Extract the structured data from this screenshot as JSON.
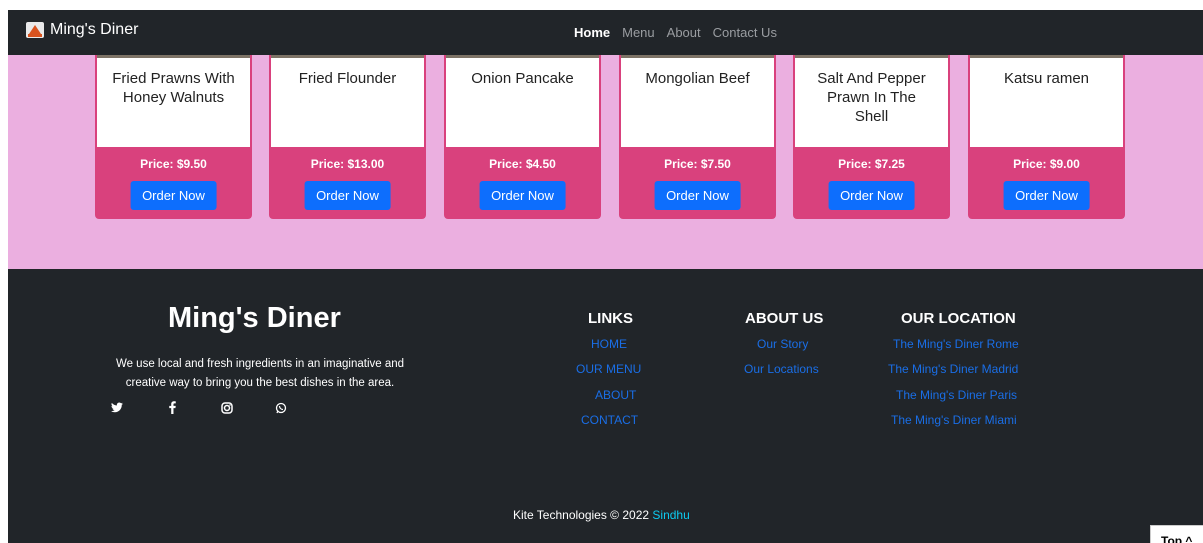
{
  "navbar": {
    "brand": "Ming's Diner",
    "links": [
      "Home",
      "Menu",
      "About",
      "Contact Us"
    ]
  },
  "menu": {
    "cards": [
      {
        "title": "Fried Prawns With Honey Walnuts",
        "price": "Price: $9.50",
        "button": "Order Now"
      },
      {
        "title": "Fried Flounder",
        "price": "Price: $13.00",
        "button": "Order Now"
      },
      {
        "title": "Onion Pancake",
        "price": "Price: $4.50",
        "button": "Order Now"
      },
      {
        "title": "Mongolian Beef",
        "price": "Price: $7.50",
        "button": "Order Now"
      },
      {
        "title": "Salt And Pepper Prawn In The Shell",
        "price": "Price: $7.25",
        "button": "Order Now"
      },
      {
        "title": "Katsu ramen",
        "price": "Price: $9.00",
        "button": "Order Now"
      }
    ]
  },
  "footer": {
    "title": "Ming's Diner",
    "description": "We use local and fresh ingredients in an imaginative and creative way to bring you the best dishes in the area.",
    "social_icons": [
      "twitter-icon",
      "facebook-icon",
      "instagram-icon",
      "whatsapp-icon"
    ],
    "links": {
      "title": "LINKS",
      "items": [
        "HOME",
        "OUR MENU",
        "ABOUT",
        "CONTACT"
      ]
    },
    "about": {
      "title": "ABOUT US",
      "items": [
        "Our Story",
        "Our Locations"
      ]
    },
    "locations": {
      "title": "OUR LOCATION",
      "items": [
        "The Ming's Diner Rome",
        "The Ming's Diner Madrid",
        "The Ming's Diner Paris",
        "The Ming's Diner Miami"
      ]
    },
    "copyright": "Kite Technologies © 2022",
    "author": "Sindhu",
    "top_button": "Top ^"
  },
  "colors": {
    "nav_bg": "#212529",
    "menu_bg": "#ebafe0",
    "card_accent": "#d9417d",
    "button_bg": "#0d6efd",
    "link_color": "#1a6ee6"
  }
}
